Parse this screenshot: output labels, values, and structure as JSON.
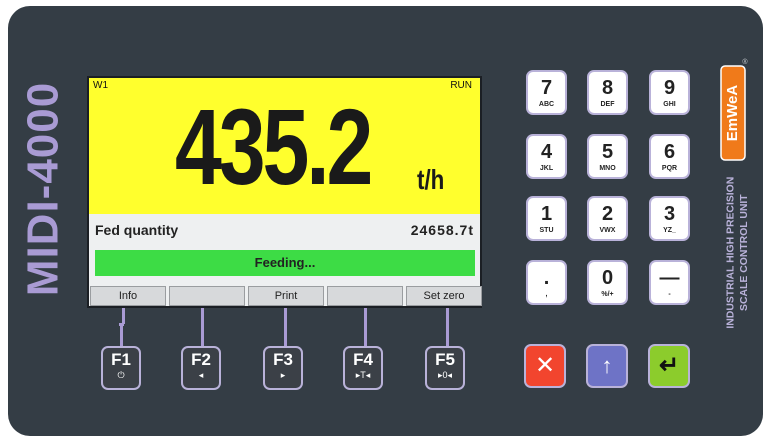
{
  "device": {
    "model": "MIDI-4000",
    "side_text_line1": "INDUSTRIAL HIGH PRECISION",
    "side_text_line2": "SCALE CONTROL UNIT",
    "logo_text": "EmWeA",
    "registered": "®"
  },
  "display": {
    "channel": "W1",
    "state": "RUN",
    "main_value": "435.2",
    "main_unit": "t/h",
    "fed_label": "Fed quantity",
    "fed_value": "24658.7t",
    "status_bar": "Feeding...",
    "softkeys": [
      "Info",
      "",
      "Print",
      "",
      "Set zero"
    ]
  },
  "function_keys": [
    {
      "label": "F1",
      "sub": "⏻"
    },
    {
      "label": "F2",
      "sub": "◂"
    },
    {
      "label": "F3",
      "sub": "▸"
    },
    {
      "label": "F4",
      "sub": "▸T◂"
    },
    {
      "label": "F5",
      "sub": "▸0◂"
    }
  ],
  "keypad": [
    {
      "num": "7",
      "letters": "ABC"
    },
    {
      "num": "8",
      "letters": "DEF"
    },
    {
      "num": "9",
      "letters": "GHI"
    },
    {
      "num": "4",
      "letters": "JKL"
    },
    {
      "num": "5",
      "letters": "MNO"
    },
    {
      "num": "6",
      "letters": "PQR"
    },
    {
      "num": "1",
      "letters": "STU"
    },
    {
      "num": "2",
      "letters": "VWX"
    },
    {
      "num": "3",
      "letters": "YZ_"
    },
    {
      "num": ".",
      "letters": ","
    },
    {
      "num": "0",
      "letters": "%/+"
    },
    {
      "num": "—",
      "letters": "-"
    }
  ],
  "control_keys": {
    "cancel": "✕",
    "up": "↑",
    "enter": "↵"
  },
  "colors": {
    "panel": "#343d45",
    "display_yellow": "#ffff2d",
    "status_green": "#3ddc45",
    "key_border": "#b9b2d9",
    "cancel_red": "#f2452e",
    "up_blue": "#6e73c6",
    "enter_green": "#8ccc2c",
    "logo_orange": "#f07a1a"
  }
}
